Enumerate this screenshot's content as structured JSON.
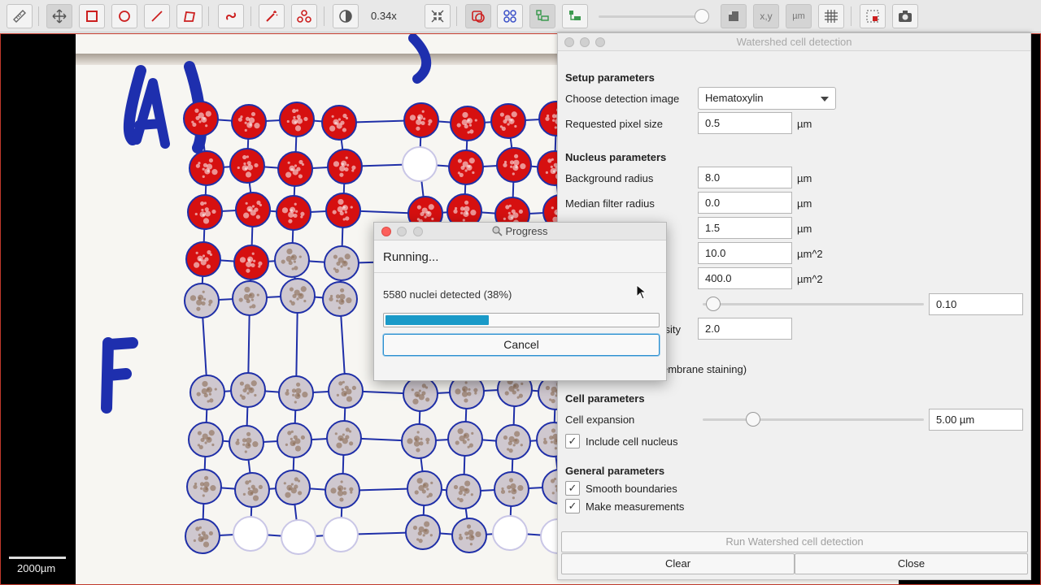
{
  "toolbar": {
    "zoom": "0.34x",
    "coord_label": "x,y",
    "unit_label": "µm",
    "icons": [
      "ruler-icon",
      "move-icon",
      "rectangle-icon",
      "ellipse-icon",
      "line-icon",
      "polygon-icon",
      "brush-icon",
      "wand-icon",
      "points-icon",
      "contrast-icon",
      "zoom-fit-icon",
      "annotations-icon",
      "tma-grid-icon",
      "detections-icon",
      "pixel-classification-icon",
      "selection-mode-icon",
      "coordinates-icon",
      "scalebar-icon",
      "grid-icon",
      "overview-icon",
      "camera-icon"
    ]
  },
  "viewer": {
    "scalebar_label": "2000µm",
    "colors": {
      "positive": "#d61010",
      "negative": "#9a8fae",
      "grid": "#1f2fa8",
      "marker": "#1e2fae"
    }
  },
  "panel": {
    "title": "Watershed cell detection",
    "setup_title": "Setup parameters",
    "detection_image_label": "Choose detection image",
    "detection_image_value": "Hematoxylin",
    "pixel_size_label": "Requested pixel size",
    "pixel_size_value": "0.5",
    "pixel_size_unit": "µm",
    "nucleus_title": "Nucleus parameters",
    "bg_radius_label": "Background radius",
    "bg_radius_value": "8.0",
    "bg_radius_unit": "µm",
    "median_label": "Median filter radius",
    "median_value": "0.0",
    "median_unit": "µm",
    "sigma_value": "1.5",
    "sigma_unit": "µm",
    "min_area_value": "10.0",
    "min_area_unit": "µm^2",
    "max_area_value": "400.0",
    "max_area_unit": "µm^2",
    "threshold_value": "0.10",
    "threshold_fraction": 0.0,
    "max_bg_label_partial": "ensity",
    "max_bg_value": "2.0",
    "split_label_partial": "embrane staining)",
    "cell_title": "Cell parameters",
    "cell_expansion_label": "Cell expansion",
    "cell_expansion_value": "5.00 µm",
    "cell_expansion_fraction": 0.2,
    "include_nucleus_label": "Include cell nucleus",
    "include_nucleus_checked": true,
    "general_title": "General parameters",
    "smooth_label": "Smooth boundaries",
    "smooth_checked": true,
    "measure_label": "Make measurements",
    "measure_checked": true,
    "run_label": "Run Watershed cell detection",
    "clear_label": "Clear",
    "close_label": "Close"
  },
  "progress": {
    "title": "Progress",
    "running": "Running...",
    "status": "5580 nuclei detected (38%)",
    "fraction": 0.38,
    "cancel_label": "Cancel"
  }
}
